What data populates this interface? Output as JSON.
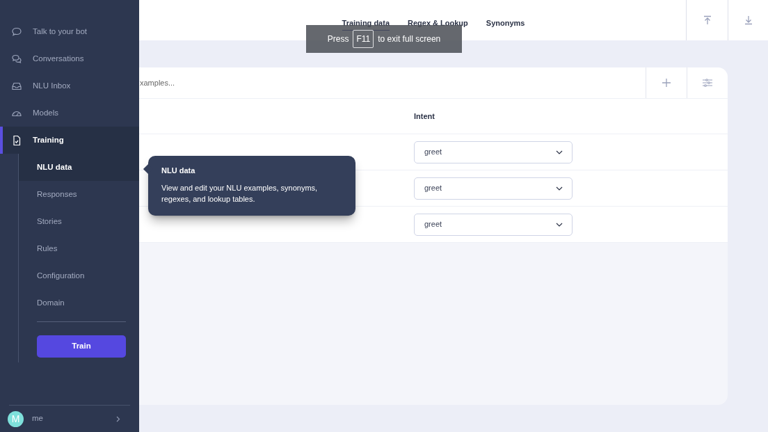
{
  "sidebar": {
    "items": [
      {
        "label": "Talk to your bot",
        "selected": false
      },
      {
        "label": "Conversations",
        "selected": false
      },
      {
        "label": "NLU Inbox",
        "selected": false
      },
      {
        "label": "Models",
        "selected": false
      },
      {
        "label": "Training",
        "selected": true,
        "expanded": true,
        "children": [
          {
            "label": "NLU data",
            "selected": true
          },
          {
            "label": "Responses",
            "selected": false
          },
          {
            "label": "Stories",
            "selected": false
          },
          {
            "label": "Rules",
            "selected": false
          },
          {
            "label": "Configuration",
            "selected": false
          },
          {
            "label": "Domain",
            "selected": false
          }
        ]
      }
    ],
    "train_button": "Train",
    "user": {
      "initial": "M",
      "name": "me"
    }
  },
  "tabs": [
    {
      "label": "Training data",
      "selected": true
    },
    {
      "label": "Regex & Lookup",
      "selected": false
    },
    {
      "label": "Synonyms",
      "selected": false
    }
  ],
  "search": {
    "placeholder": "xamples..."
  },
  "table": {
    "columns": [
      {
        "label": "Intent"
      }
    ],
    "rows": [
      {
        "intent": "greet"
      },
      {
        "intent": "greet"
      },
      {
        "intent": "greet"
      }
    ]
  },
  "tooltip": {
    "title": "NLU data",
    "text": "View and edit your NLU examples, synonyms, regexes, and lookup tables."
  },
  "fullscreen_notice": {
    "before": "Press",
    "key": "F11",
    "after": "to exit full screen"
  }
}
